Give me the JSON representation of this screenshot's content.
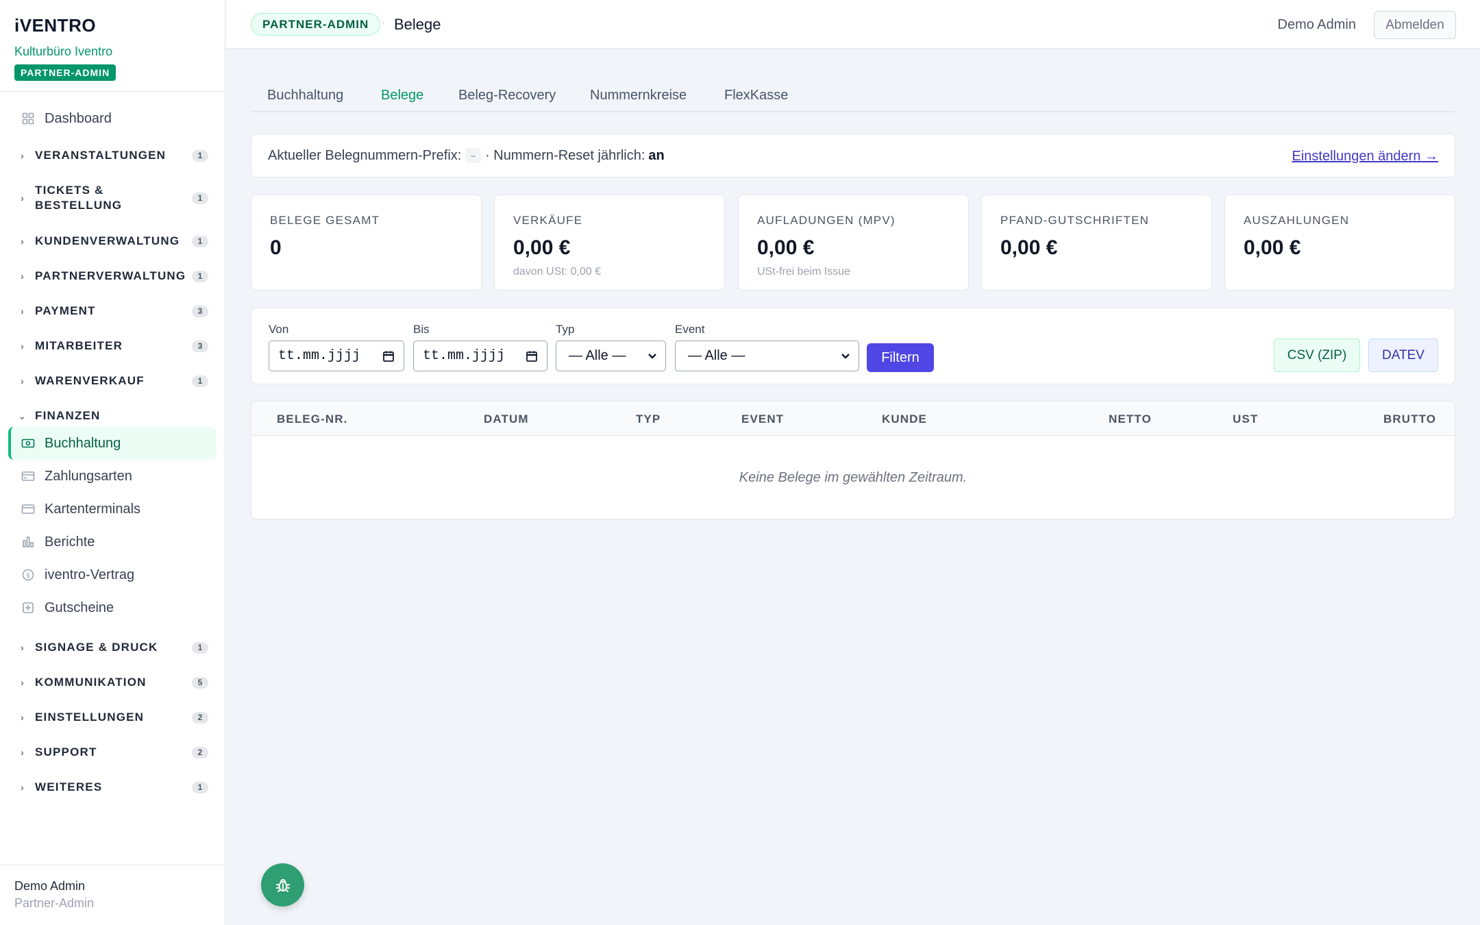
{
  "brand": {
    "logo": "iVENTRO",
    "org": "Kulturbüro Iventro",
    "badge": "PARTNER-ADMIN"
  },
  "sidebar": {
    "dashboard": "Dashboard",
    "groups": [
      {
        "label": "VERANSTALTUNGEN",
        "count": "1"
      },
      {
        "label": "TICKETS &",
        "label2": "BESTELLUNG",
        "count": "1"
      },
      {
        "label": "KUNDENVERWALTUNG",
        "count": "1"
      },
      {
        "label": "PARTNERVERWALTUNG",
        "count": "1"
      },
      {
        "label": "PAYMENT",
        "count": "3"
      },
      {
        "label": "MITARBEITER",
        "count": "3"
      },
      {
        "label": "WARENVERKAUF",
        "count": "1"
      },
      {
        "label": "FINANZEN"
      },
      {
        "label": "SIGNAGE & DRUCK",
        "count": "1"
      },
      {
        "label": "KOMMUNIKATION",
        "count": "5"
      },
      {
        "label": "EINSTELLUNGEN",
        "count": "2"
      },
      {
        "label": "SUPPORT",
        "count": "2"
      },
      {
        "label": "WEITERES",
        "count": "1"
      }
    ],
    "finanzen_items": [
      "Buchhaltung",
      "Zahlungsarten",
      "Kartenterminals",
      "Berichte",
      "iventro-Vertrag",
      "Gutscheine"
    ],
    "footer": {
      "name": "Demo Admin",
      "role": "Partner-Admin"
    }
  },
  "header": {
    "role": "PARTNER-ADMIN",
    "separator": "·",
    "title": "Belege",
    "user": "Demo Admin",
    "logout": "Abmelden"
  },
  "tabs": [
    "Buchhaltung",
    "Belege",
    "Beleg-Recovery",
    "Nummernkreise",
    "FlexKasse"
  ],
  "info": {
    "prefix_label": "Aktueller Belegnummern-Prefix:",
    "prefix_value": "–",
    "reset_label": "· Nummern-Reset jährlich:",
    "reset_value": "an",
    "link": "Einstellungen ändern →"
  },
  "stats": [
    {
      "label": "BELEGE GESAMT",
      "value": "0",
      "sub": ""
    },
    {
      "label": "VERKÄUFE",
      "value": "0,00 €",
      "sub": "davon USt: 0,00 €"
    },
    {
      "label": "AUFLADUNGEN (MPV)",
      "value": "0,00 €",
      "sub": "USt-frei beim Issue"
    },
    {
      "label": "PFAND-GUTSCHRIFTEN",
      "value": "0,00 €",
      "sub": ""
    },
    {
      "label": "AUSZAHLUNGEN",
      "value": "0,00 €",
      "sub": ""
    }
  ],
  "filter": {
    "von_label": "Von",
    "von_value": "tt.mm.jjjj",
    "bis_label": "Bis",
    "bis_value": "tt.mm.jjjj",
    "typ_label": "Typ",
    "typ_value": "— Alle —",
    "event_label": "Event",
    "event_value": "— Alle —",
    "filter_button": "Filtern",
    "csv_button": "CSV (ZIP)",
    "datev_button": "DATEV"
  },
  "table": {
    "columns": [
      "BELEG-NR.",
      "DATUM",
      "TYP",
      "EVENT",
      "KUNDE",
      "NETTO",
      "UST",
      "BRUTTO"
    ],
    "empty": "Keine Belege im gewählten Zeitraum."
  },
  "colors": {
    "accent": "#059669",
    "primary_button": "#4f46e5",
    "fab": "#2f9e73"
  }
}
